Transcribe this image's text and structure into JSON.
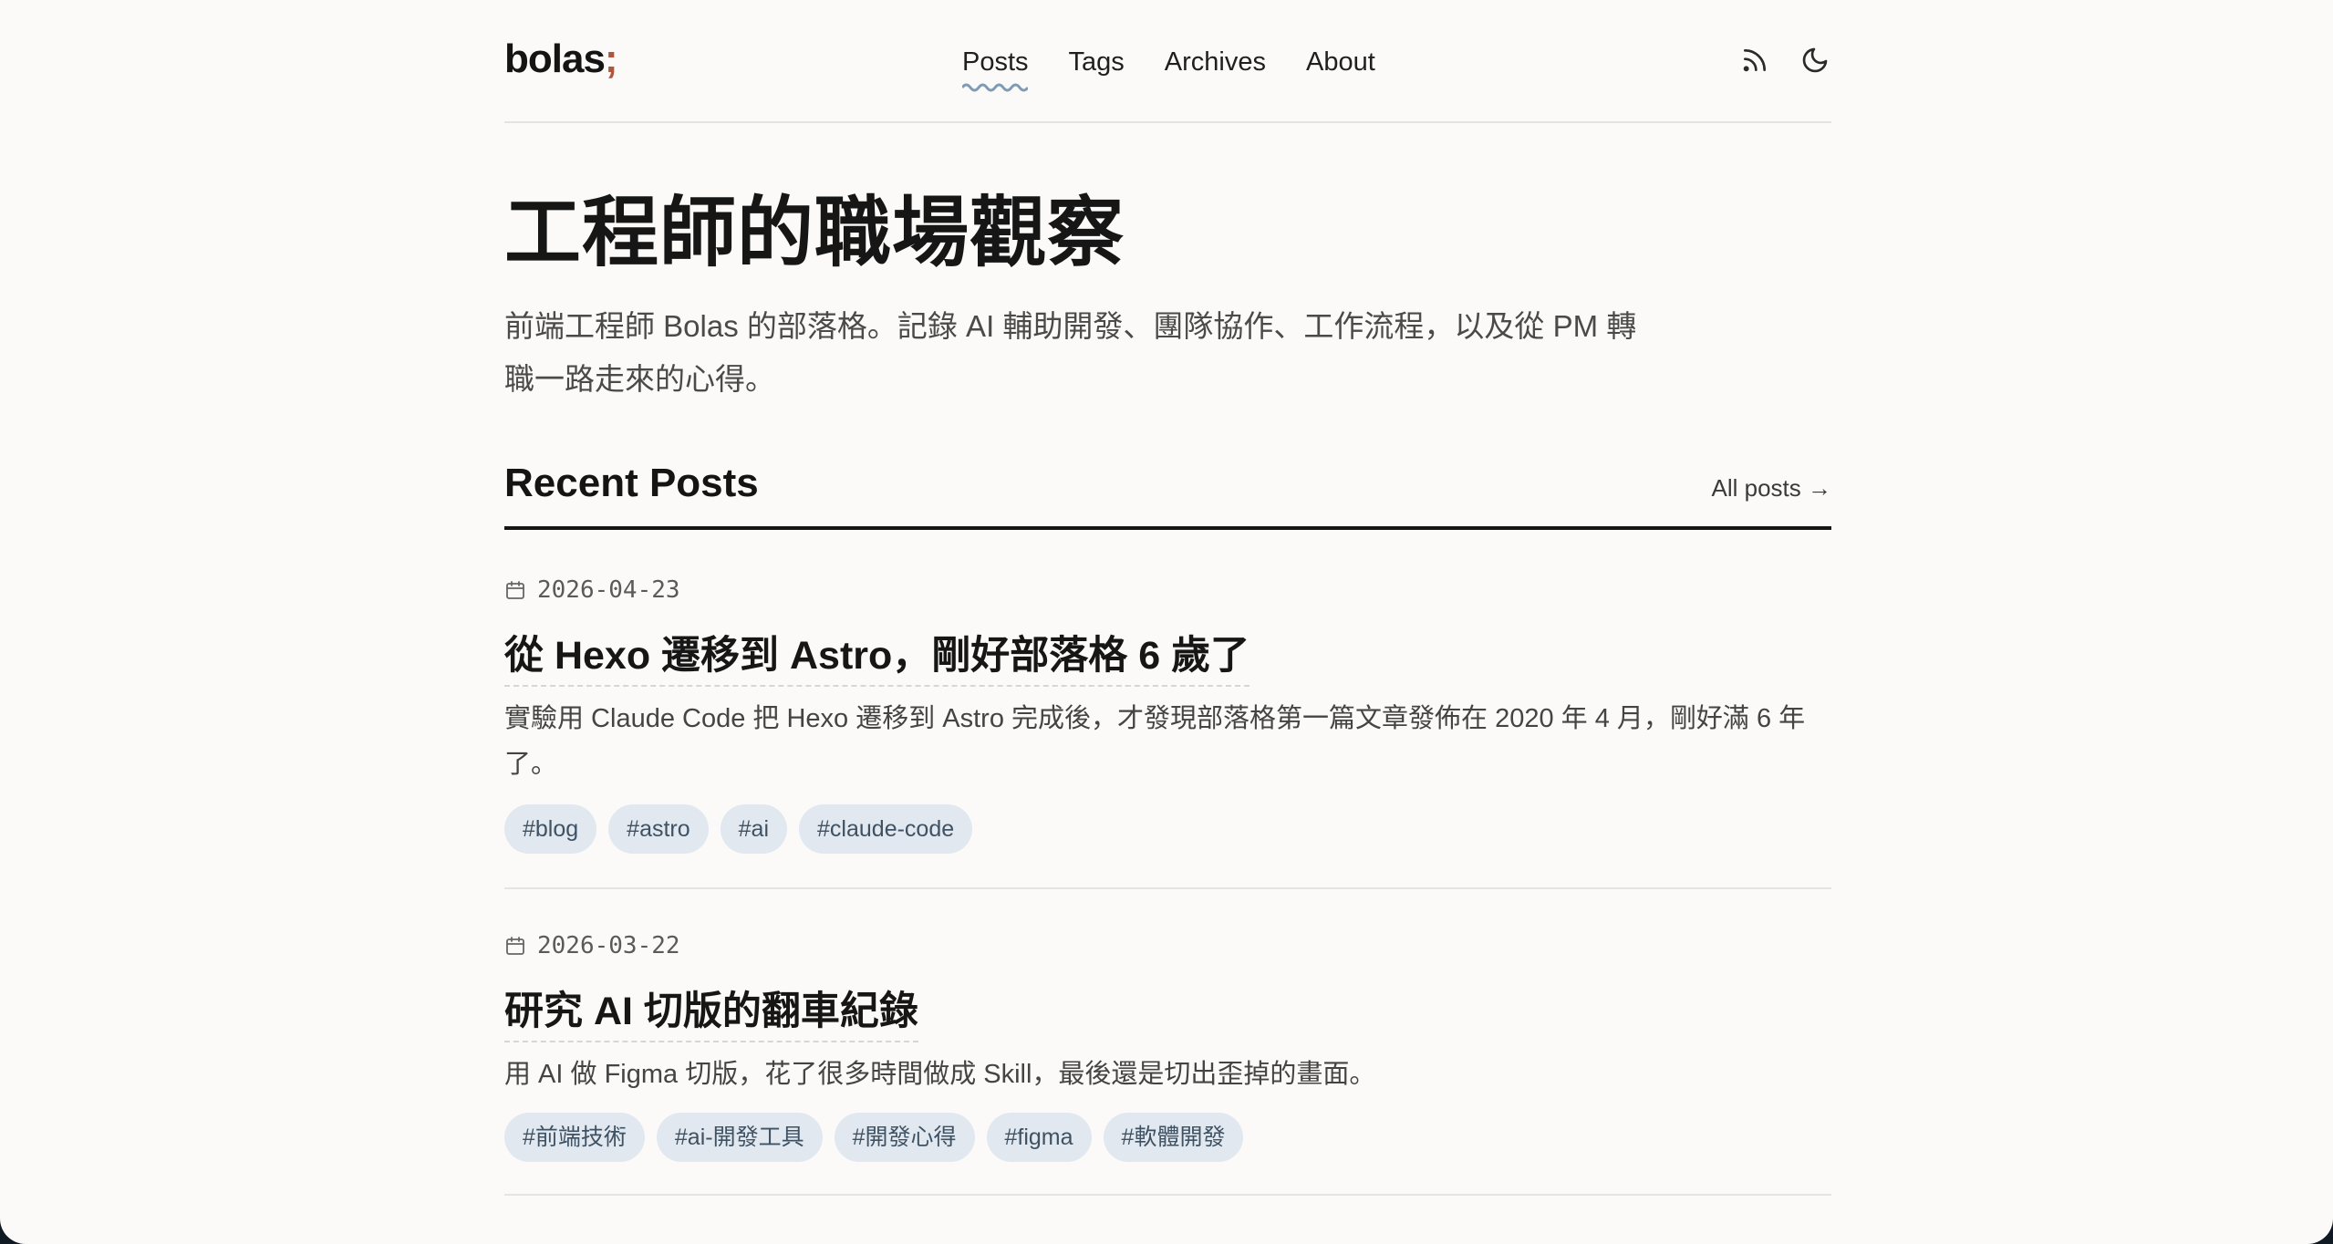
{
  "site": {
    "logo_text": "bolas",
    "logo_suffix": ";",
    "accent_color": "#b0563e",
    "tag_bg_color": "#e2e8ef"
  },
  "nav": {
    "items": [
      {
        "label": "Posts",
        "active": true
      },
      {
        "label": "Tags",
        "active": false
      },
      {
        "label": "Archives",
        "active": false
      },
      {
        "label": "About",
        "active": false
      }
    ],
    "icons": [
      "rss-icon",
      "moon-icon"
    ]
  },
  "hero": {
    "title": "工程師的職場觀察",
    "description": "前端工程師 Bolas 的部落格。記錄 AI 輔助開發、團隊協作、工作流程，以及從 PM 轉職一路走來的心得。"
  },
  "recent": {
    "heading": "Recent Posts",
    "all_posts_label": "All posts →"
  },
  "posts": [
    {
      "date": "2026-04-23",
      "title": "從 Hexo 遷移到 Astro，剛好部落格 6 歲了",
      "excerpt": "實驗用 Claude Code 把 Hexo 遷移到 Astro 完成後，才發現部落格第一篇文章發佈在 2020 年 4 月，剛好滿 6 年了。",
      "tags": [
        "#blog",
        "#astro",
        "#ai",
        "#claude-code"
      ]
    },
    {
      "date": "2026-03-22",
      "title": "研究 AI 切版的翻車紀錄",
      "excerpt": "用 AI 做 Figma 切版，花了很多時間做成 Skill，最後還是切出歪掉的畫面。",
      "tags": [
        "#前端技術",
        "#ai-開發工具",
        "#開發心得",
        "#figma",
        "#軟體開發"
      ]
    }
  ]
}
